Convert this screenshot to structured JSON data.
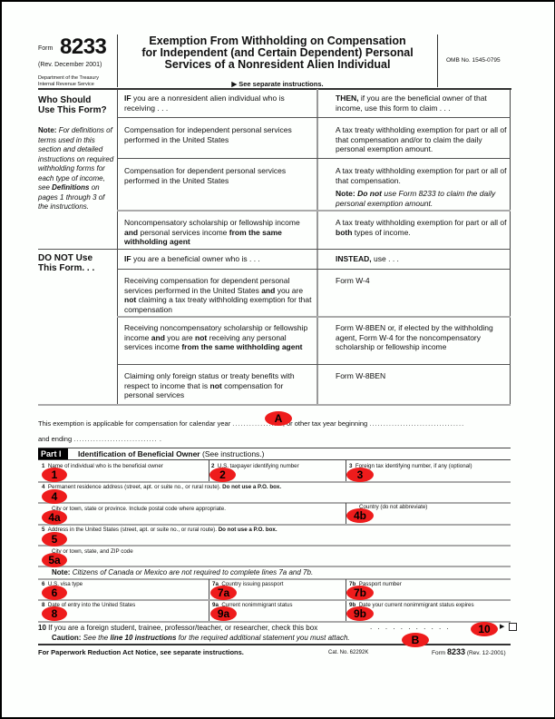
{
  "header": {
    "form_label": "Form",
    "form_number": "8233",
    "revision": "(Rev. December 2001)",
    "department_line1": "Department of the Treasury",
    "department_line2": "Internal Revenue Service",
    "title_line1": "Exemption From Withholding on Compensation",
    "title_line2": "for Independent (and Certain Dependent) Personal",
    "title_line3": "Services of a Nonresident Alien Individual",
    "see_instructions": "▶ See separate instructions.",
    "omb": "OMB No. 1545-0795"
  },
  "who_should": {
    "heading_line1": "Who Should",
    "heading_line2": "Use This Form?",
    "note_label": "Note:",
    "note_text_1": "For definitions of terms used in this section and detailed instructions on required withholding forms for each type of income, see",
    "note_bold": "Definitions",
    "note_text_2": "on pages 1 through 3 of the instructions.",
    "if_bold": "IF",
    "if_text": "you are a nonresident alien individual who is receiving . . .",
    "then_bold": "THEN,",
    "then_text": "if you are the beneficial owner of that income, use this form to claim . . .",
    "rows": [
      {
        "income": "Compensation for independent personal services performed in the United States",
        "claim": "A tax treaty withholding exemption for part or all of that compensation and/or to claim the daily personal exemption amount."
      },
      {
        "income": "Compensation for dependent personal services performed in the United States",
        "claim": "A tax treaty withholding exemption for part or all of that compensation.",
        "claim_note_label": "Note:",
        "claim_note_bold": "Do not",
        "claim_note_text": "use Form 8233 to claim the daily personal exemption amount."
      },
      {
        "income_a": "Noncompensatory scholarship or fellowship income",
        "income_and": "and",
        "income_b": "personal services income",
        "income_bold": "from the same withholding agent",
        "claim_a": "A tax treaty withholding exemption for part or all of",
        "claim_bold": "both",
        "claim_b": "types of income."
      }
    ]
  },
  "do_not_use": {
    "heading_line1": "DO NOT Use",
    "heading_line2": "This Form. . .",
    "if_bold": "IF",
    "if_text": "you are a beneficial owner who is . . .",
    "instead_bold": "INSTEAD,",
    "instead_text": "use . . .",
    "rows": [
      {
        "who_a": "Receiving compensation for dependent personal services performed in the United States",
        "who_and": "and",
        "who_b": "you are",
        "who_not": "not",
        "who_c": "claiming a tax treaty withholding exemption for that compensation",
        "use": "Form W-4"
      },
      {
        "who_a": "Receiving noncompensatory scholarship or fellowship income",
        "who_and": "and",
        "who_b": "you are",
        "who_not": "not",
        "who_c": "receiving any personal services income",
        "who_bold": "from the same withholding agent",
        "use": "Form W-8BEN or, if elected by the withholding agent, Form W-4 for the noncompensatory scholarship or fellowship income"
      },
      {
        "who_a": "Claiming only foreign status or treaty benefits with respect to income that is",
        "who_not": "not",
        "who_c": "compensation for personal services",
        "use": "Form W-8BEN"
      }
    ]
  },
  "exemption": {
    "line1_a": "This exemption is applicable for compensation for calendar year",
    "line1_dots1": "..................",
    "line1_b": ", or other tax year beginning",
    "line1_dots2": "..................................",
    "line2_a": "and ending",
    "line2_dots": "..............................",
    "line2_end": "."
  },
  "part1": {
    "label": "Part I",
    "title": "Identification of Beneficial Owner",
    "title_suffix": "(See instructions.)",
    "fields": {
      "f1_num": "1",
      "f1_label": "Name of individual who is the beneficial owner",
      "f2_num": "2",
      "f2_label": "U.S. taxpayer identifying number",
      "f3_num": "3",
      "f3_label": "Foreign tax identifying number, if any (optional)",
      "f4_num": "4",
      "f4_label": "Permanent residence address (street, apt. or suite no., or rural route).",
      "f4_bold": "Do not use a P.O. box.",
      "f4a_label": "City or town, state or province. Include postal code where appropriate.",
      "f4b_label": "Country (do not abbreviate)",
      "f5_num": "5",
      "f5_label": "Address in the United States (street, apt. or suite no., or rural route).",
      "f5_bold": "Do not use a P.O. box.",
      "f5a_label": "City or town, state, and ZIP code",
      "note_bold": "Note:",
      "note_text": "Citizens of Canada or Mexico are not required to complete lines 7a and 7b.",
      "f6_num": "6",
      "f6_label": "U.S. visa type",
      "f7a_num": "7a",
      "f7a_label": "Country issuing passport",
      "f7b_num": "7b",
      "f7b_label": "Passport number",
      "f8_num": "8",
      "f8_label": "Date of entry into the United States",
      "f9a_num": "9a",
      "f9a_label": "Current nonimmigrant status",
      "f9b_num": "9b",
      "f9b_label": "Date your current nonimmigrant status expires",
      "f10_num": "10",
      "f10_label": "If you are a foreign student, trainee, professor/teacher, or researcher, check this box",
      "f10_dots": ". . . . . . . . . . .",
      "f10_arrow": "▶",
      "caution_bold": "Caution:",
      "caution_a": "See the",
      "caution_bold2": "line 10 instructions",
      "caution_b": "for the required additional statement you must attach."
    }
  },
  "footer": {
    "paperwork": "For Paperwork Reduction Act Notice, see separate instructions.",
    "cat_no": "Cat. No. 62292K",
    "form_label": "Form",
    "form_number": "8233",
    "rev": "(Rev. 12-2001)"
  },
  "markers": {
    "A": "A",
    "B": "B",
    "m1": "1",
    "m2": "2",
    "m3": "3",
    "m4": "4",
    "m4a": "4a",
    "m4b": "4b",
    "m5": "5",
    "m5a": "5a",
    "m6": "6",
    "m7a": "7a",
    "m7b": "7b",
    "m8": "8",
    "m9a": "9a",
    "m9b": "9b",
    "m10": "10"
  },
  "colors": {
    "marker_red": "#ee1c1c",
    "text": "#111111",
    "background": "#fdfffd"
  }
}
